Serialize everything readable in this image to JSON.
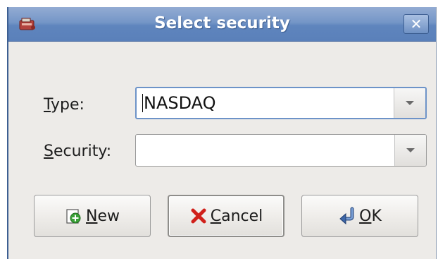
{
  "window": {
    "title": "Select security",
    "close_glyph": "✕",
    "app_icon": "app-icon"
  },
  "form": {
    "type": {
      "label_mnemonic": "T",
      "label_rest": "ype:",
      "value": "NASDAQ"
    },
    "security": {
      "label_mnemonic": "S",
      "label_rest": "ecurity:",
      "value": ""
    }
  },
  "buttons": {
    "new": {
      "mnemonic": "N",
      "rest": "ew",
      "icon": "add-document-icon"
    },
    "cancel": {
      "mnemonic": "C",
      "rest": "ancel",
      "icon": "red-x-icon"
    },
    "ok": {
      "mnemonic": "O",
      "rest": "K",
      "icon": "return-arrow-icon"
    }
  },
  "colors": {
    "titlebar": "#5f85bd",
    "dialog_bg": "#edebe8",
    "focus_border": "#6d93c8",
    "cancel_x": "#d0201a",
    "new_plus": "#3aa137"
  }
}
